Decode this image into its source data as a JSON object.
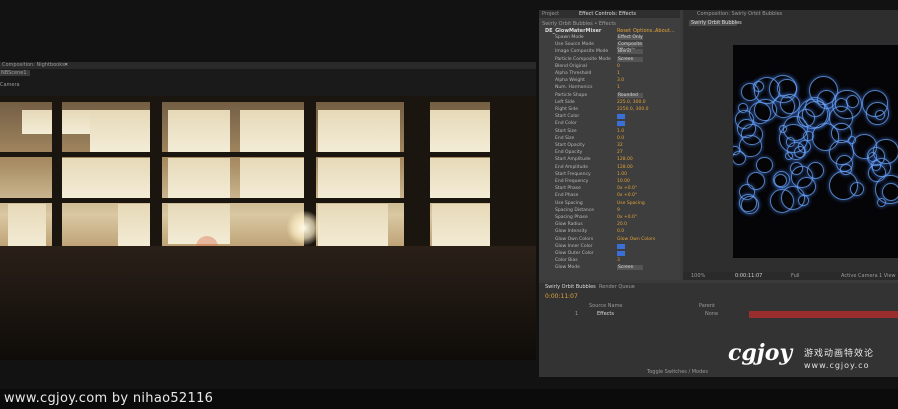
{
  "left_window": {
    "title": "Composition: Nightbooks",
    "tab": "NBScene1",
    "camera_label": "Camera"
  },
  "effect_controls": {
    "tab_project": "Project",
    "tab_effect": "Effect Controls: Effects",
    "breadcrumb": "Swirly Orbit Bubbles • Effects",
    "plugin_name": "DE_GlowMaterMixer",
    "plugin_links": [
      "Reset",
      "Options...",
      "About..."
    ],
    "rows": [
      {
        "label": "Spawn Mode",
        "val": "",
        "btn": "Effect Only"
      },
      {
        "label": "Use Source Mode",
        "val": "",
        "btn": "Composite Effect In"
      },
      {
        "label": "Image Composite Mode",
        "val": "",
        "btn": "Blend"
      },
      {
        "label": "Particle Composite Mode",
        "val": "",
        "btn": "Screen"
      },
      {
        "label": "Blend Original",
        "val": "0",
        "btn": ""
      },
      {
        "label": "Alpha Threshold",
        "val": "1",
        "btn": ""
      },
      {
        "label": "Alpha Weight",
        "val": "3.0",
        "btn": ""
      },
      {
        "label": "Num. Harmonics",
        "val": "1",
        "btn": ""
      },
      {
        "label": "Particle Shape",
        "val": "",
        "btn": "Rounded"
      },
      {
        "label": "Left Side",
        "val": "225.0, 300.0",
        "btn": ""
      },
      {
        "label": "Right Side",
        "val": "2250.0, 300.0",
        "btn": ""
      },
      {
        "label": "Start Color",
        "val": "",
        "btn": ""
      },
      {
        "label": "End Color",
        "val": "",
        "btn": ""
      },
      {
        "label": "Start Size",
        "val": "1.0",
        "btn": ""
      },
      {
        "label": "End Size",
        "val": "0.0",
        "btn": ""
      },
      {
        "label": "Start Opacity",
        "val": "32",
        "btn": ""
      },
      {
        "label": "End Opacity",
        "val": "27",
        "btn": ""
      },
      {
        "label": "Start Amplitude",
        "val": "128.00",
        "btn": ""
      },
      {
        "label": "End Amplitude",
        "val": "128.00",
        "btn": ""
      },
      {
        "label": "Start Frequency",
        "val": "1.00",
        "btn": ""
      },
      {
        "label": "End Frequency",
        "val": "10.00",
        "btn": ""
      },
      {
        "label": "Start Phase",
        "val": "0x +0.0°",
        "btn": ""
      },
      {
        "label": "End Phase",
        "val": "0x +0.0°",
        "btn": ""
      },
      {
        "label": "Use Spacing",
        "val": "Use Spacing",
        "btn": ""
      },
      {
        "label": "Spacing Distance",
        "val": "9",
        "btn": ""
      },
      {
        "label": "Spacing Phase",
        "val": "0x +0.0°",
        "btn": ""
      },
      {
        "label": "Glow Radius",
        "val": "20.0",
        "btn": ""
      },
      {
        "label": "Glow Intensity",
        "val": "0.0",
        "btn": ""
      },
      {
        "label": "Glow Own Colors",
        "val": "Glow Own Colors",
        "btn": ""
      },
      {
        "label": "Glow Inner Color",
        "val": "",
        "btn": ""
      },
      {
        "label": "Glow Outer Color",
        "val": "",
        "btn": ""
      },
      {
        "label": "Color Bias",
        "val": "3",
        "btn": ""
      },
      {
        "label": "Glow Mode",
        "val": "",
        "btn": "Screen"
      }
    ]
  },
  "right_comp": {
    "title": "Composition: Swirly Orbit Bubbles",
    "tab": "Swirly Orbit Bubbles",
    "footer": [
      "100%",
      "0:00:11:07",
      "Full",
      "Active Camera",
      "1 View"
    ]
  },
  "timeline": {
    "tab1": "Swirly Orbit Bubbles",
    "tab2": "Render Queue",
    "timecode": "0:00:11:07",
    "col_source": "Source Name",
    "col_parent": "Parent",
    "layer_num": "1",
    "layer_name": "Effects",
    "parent_val": "None",
    "footer_btn": "Toggle Switches / Modes"
  },
  "watermark": {
    "credit": "www.cgjoy.com by nihao52116",
    "logo": "cgjoy",
    "logo_cn": "游戏动画特效论",
    "logo_url": "www.cgjoy.co"
  },
  "colors": {
    "accent_orange": "#e0a23a",
    "track_red": "#9a2e2e",
    "bubble_blue": "#6eaaff"
  }
}
